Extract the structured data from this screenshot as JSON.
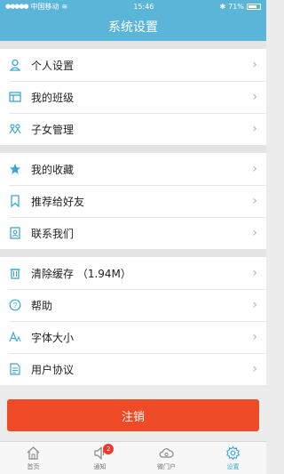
{
  "status_bar": {
    "carrier": "中国移动",
    "time": "15:46",
    "battery": "71%",
    "battery_level": 0.71
  },
  "header": {
    "title": "系统设置"
  },
  "groups": [
    [
      {
        "label": "个人设置",
        "icon": "person-icon"
      },
      {
        "label": "我的班级",
        "icon": "class-icon"
      },
      {
        "label": "子女管理",
        "icon": "children-icon"
      }
    ],
    [
      {
        "label": "我的收藏",
        "icon": "star-icon"
      },
      {
        "label": "推荐给好友",
        "icon": "bookmark-icon"
      },
      {
        "label": "联系我们",
        "icon": "contact-icon"
      }
    ],
    [
      {
        "label": "清除缓存 （1.94M）",
        "icon": "trash-icon"
      },
      {
        "label": "帮助",
        "icon": "help-icon"
      },
      {
        "label": "字体大小",
        "icon": "font-size-icon"
      },
      {
        "label": "用户协议",
        "icon": "document-icon"
      }
    ]
  ],
  "logout_label": "注销",
  "tabs": [
    {
      "label": "首页",
      "icon": "home-icon"
    },
    {
      "label": "通知",
      "icon": "speaker-icon",
      "badge": "2"
    },
    {
      "label": "微门户",
      "icon": "cloud-icon"
    },
    {
      "label": "设置",
      "icon": "gear-icon",
      "active": true
    }
  ],
  "colors": {
    "accent": "#5bb5d8",
    "icon": "#3aa8d6",
    "logout": "#ee4b26",
    "badge": "#ee3a2a"
  }
}
